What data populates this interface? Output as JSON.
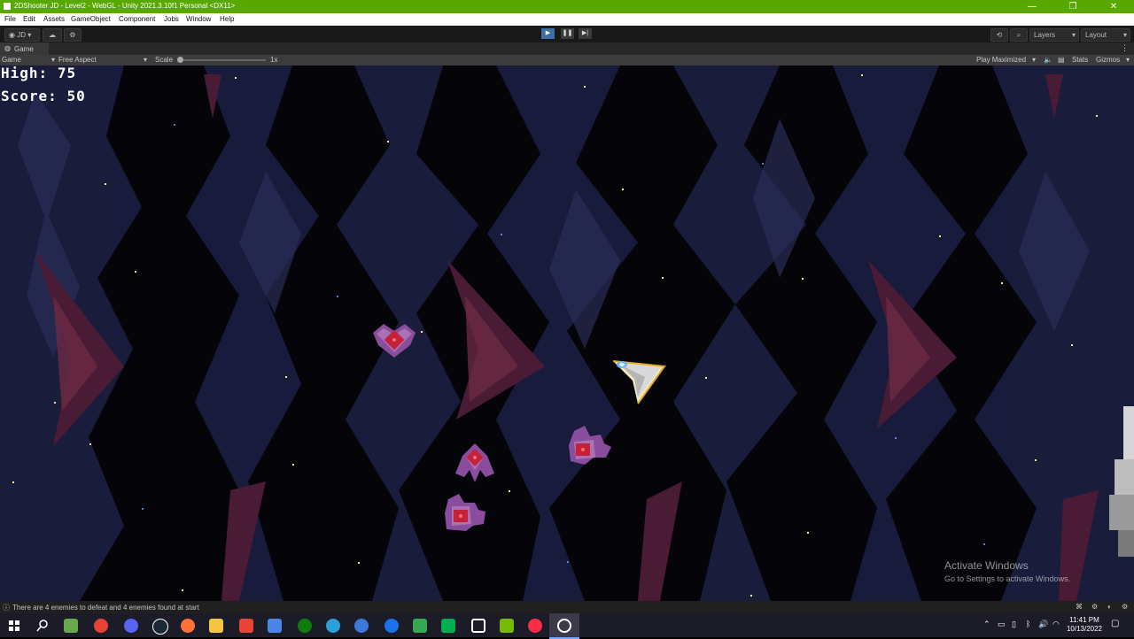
{
  "window": {
    "title": "2DShooter JD - Level2 - WebGL - Unity 2021.3.10f1 Personal <DX11>",
    "minimize": "—",
    "restore": "❐",
    "close": "✕"
  },
  "menu": [
    "File",
    "Edit",
    "Assets",
    "GameObject",
    "Component",
    "Jobs",
    "Window",
    "Help"
  ],
  "toolbar": {
    "account": "JD",
    "play": "▶",
    "pause": "❚❚",
    "step": "▶|",
    "layers": "Layers",
    "layout": "Layout"
  },
  "game_tab": {
    "label": "Game"
  },
  "game_view": {
    "display": "Game",
    "aspect": "Free Aspect",
    "scale_label": "Scale",
    "scale_value": "1x",
    "play_mode": "Play Maximized",
    "stats": "Stats",
    "gizmos": "Gizmos"
  },
  "hud": {
    "high_label": "High:",
    "high_value": "75",
    "score_label": "Score:",
    "score_value": "50"
  },
  "activation": {
    "heading": "Activate Windows",
    "subtext": "Go to Settings to activate Windows."
  },
  "status": {
    "message": "There are 4 enemies to defeat and 4 enemies found at start"
  },
  "taskbar": {
    "time": "11:41 PM",
    "date": "10/13/2022",
    "icons": [
      {
        "name": "windows-start-icon",
        "color": "#ffffff"
      },
      {
        "name": "search-icon",
        "color": "#ffffff"
      },
      {
        "name": "minecraft-icon",
        "color": "#6aa84f"
      },
      {
        "name": "chrome-icon",
        "color": "#e94235"
      },
      {
        "name": "discord-icon",
        "color": "#5865f2"
      },
      {
        "name": "steam-icon",
        "color": "#1b2838"
      },
      {
        "name": "firefox-icon",
        "color": "#ff7139"
      },
      {
        "name": "file-explorer-icon",
        "color": "#f4c542"
      },
      {
        "name": "gmail-icon",
        "color": "#ea4335"
      },
      {
        "name": "files-icon",
        "color": "#4a86e8"
      },
      {
        "name": "xbox-icon",
        "color": "#107c10"
      },
      {
        "name": "edge-icon",
        "color": "#2b9fd8"
      },
      {
        "name": "app-icon",
        "color": "#3c78d8"
      },
      {
        "name": "app-icon",
        "color": "#1a73e8"
      },
      {
        "name": "drive-icon",
        "color": "#34a853"
      },
      {
        "name": "app-icon",
        "color": "#00b050"
      },
      {
        "name": "unity-hub-icon",
        "color": "#ffffff"
      },
      {
        "name": "nvidia-icon",
        "color": "#76b900"
      },
      {
        "name": "music-icon",
        "color": "#fa2d48"
      },
      {
        "name": "unity-editor-icon",
        "color": "#ffffff"
      }
    ]
  },
  "colors": {
    "title_bar": "#59a800",
    "editor_dark": "#191919",
    "space_bg": "#050409",
    "nebula_blue": "#1b1d3f",
    "nebula_red": "#4a1b34",
    "enemy_purple": "#8a4c9c",
    "enemy_core": "#c4223a"
  }
}
